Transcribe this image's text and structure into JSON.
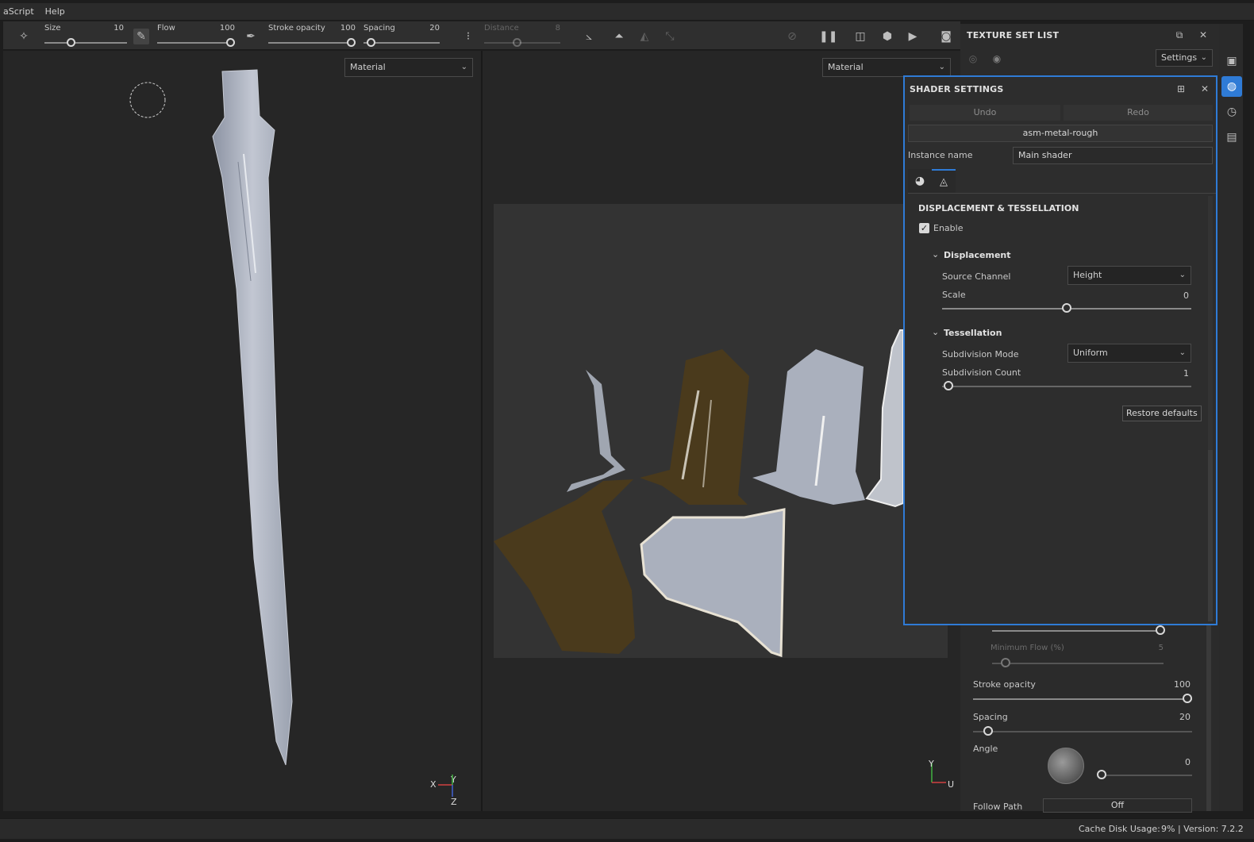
{
  "menu": [
    "aScript",
    "Help"
  ],
  "toolbar": {
    "size_label": "Size",
    "size_value": "10",
    "flow_label": "Flow",
    "flow_value": "100",
    "stroke_opacity_label": "Stroke opacity",
    "stroke_opacity_value": "100",
    "spacing_label": "Spacing",
    "spacing_value": "20",
    "distance_label": "Distance",
    "distance_value": "8"
  },
  "viewport2d": {
    "material_dropdown": "Material"
  },
  "viewport3d": {
    "material_dropdown": "Material"
  },
  "texture_set_list": {
    "title": "TEXTURE SET LIST",
    "settings_label": "Settings"
  },
  "shader_settings": {
    "title": "SHADER SETTINGS",
    "undo_label": "Undo",
    "redo_label": "Redo",
    "shader_name": "asm-metal-rough",
    "instance_name_label": "Instance name",
    "instance_name_value": "Main shader",
    "section_title": "DISPLACEMENT & TESSELLATION",
    "enable_label": "Enable",
    "enable_checked": true,
    "displacement": {
      "title": "Displacement",
      "source_channel_label": "Source Channel",
      "source_channel_value": "Height",
      "scale_label": "Scale",
      "scale_value": "0"
    },
    "tessellation": {
      "title": "Tessellation",
      "subdivision_mode_label": "Subdivision Mode",
      "subdivision_mode_value": "Uniform",
      "subdivision_count_label": "Subdivision Count",
      "subdivision_count_value": "1"
    },
    "restore_defaults_label": "Restore defaults"
  },
  "properties": {
    "minimum_flow_label": "Minimum Flow (%)",
    "minimum_flow_value": "5",
    "stroke_opacity_label": "Stroke opacity",
    "stroke_opacity_value": "100",
    "spacing_label": "Spacing",
    "spacing_value": "20",
    "angle_label": "Angle",
    "angle_value": "0",
    "follow_path_label": "Follow Path",
    "follow_path_value": "Off"
  },
  "status": {
    "cache_label": "Cache Disk Usage:",
    "cache_value": "9% | Version: 7.2.2"
  },
  "axes2d": {
    "x": "X",
    "y": "Y",
    "z": "Z"
  },
  "axes3d": {
    "y": "Y",
    "u": "U"
  },
  "colors": {
    "accent": "#2f7bd6",
    "panel": "#2d2d2d",
    "viewport": "#262626",
    "bronze": "#4a3a1c",
    "steel": "#aab0bd"
  }
}
